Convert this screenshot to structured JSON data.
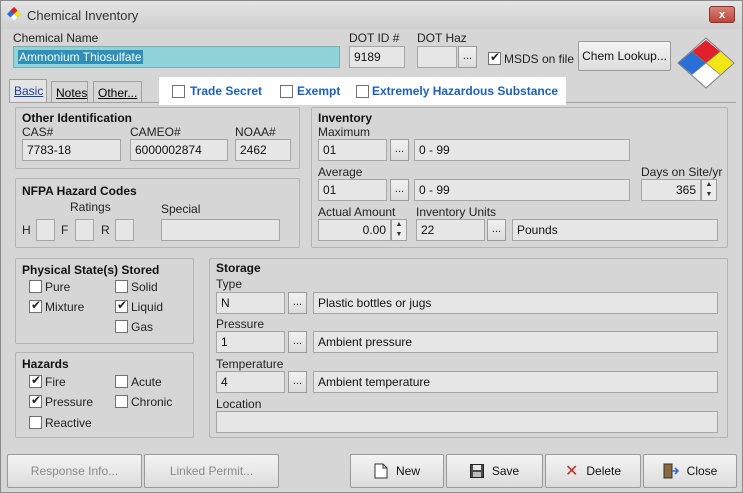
{
  "window": {
    "title": "Chemical Inventory",
    "close": "x"
  },
  "header": {
    "chemical_name_label": "Chemical Name",
    "chemical_name_value": "Ammonium Thiosulfate",
    "dot_id_label": "DOT ID #",
    "dot_id_value": "9189",
    "dot_haz_label": "DOT Haz",
    "dot_haz_value": "",
    "msds_label": "MSDS on file",
    "chem_lookup_label": "Chem Lookup..."
  },
  "tabs": [
    {
      "label": "Basic"
    },
    {
      "label": "Notes"
    },
    {
      "label": "Other..."
    }
  ],
  "flags": {
    "trade_secret": "Trade Secret",
    "exempt": "Exempt",
    "extremely_hazardous": "Extremely Hazardous Substance"
  },
  "other_identification": {
    "title": "Other Identification",
    "cas_label": "CAS#",
    "cas_value": "7783-18",
    "cameo_label": "CAMEO#",
    "cameo_value": "6000002874",
    "noaa_label": "NOAA#",
    "noaa_value": "2462"
  },
  "nfpa": {
    "title": "NFPA Hazard Codes",
    "ratings_label": "Ratings",
    "special_label": "Special",
    "h_label": "H",
    "f_label": "F",
    "r_label": "R"
  },
  "inventory": {
    "title": "Inventory",
    "maximum_label": "Maximum",
    "maximum_code": "01",
    "maximum_range": "0 - 99",
    "average_label": "Average",
    "average_code": "01",
    "average_range": "0 - 99",
    "days_label": "Days on Site/yr",
    "days_value": "365",
    "actual_label": "Actual Amount",
    "actual_value": "0.00",
    "units_label": "Inventory Units",
    "units_code": "22",
    "units_value": "Pounds"
  },
  "physical_state": {
    "title": "Physical State(s) Stored",
    "pure": "Pure",
    "solid": "Solid",
    "mixture": "Mixture",
    "liquid": "Liquid",
    "gas": "Gas"
  },
  "hazards": {
    "title": "Hazards",
    "fire": "Fire",
    "acute": "Acute",
    "pressure": "Pressure",
    "chronic": "Chronic",
    "reactive": "Reactive"
  },
  "storage": {
    "title": "Storage",
    "type_label": "Type",
    "type_code": "N",
    "type_value": "Plastic bottles or jugs",
    "pressure_label": "Pressure",
    "pressure_code": "1",
    "pressure_value": "Ambient pressure",
    "temperature_label": "Temperature",
    "temperature_code": "4",
    "temperature_value": "Ambient temperature",
    "location_label": "Location",
    "location_value": ""
  },
  "footer": {
    "response_info": "Response Info...",
    "linked_permit": "Linked Permit...",
    "new": "New",
    "save": "Save",
    "delete": "Delete",
    "close": "Close"
  },
  "dots": "...",
  "colors": {
    "selection": "#8fd3d8",
    "link": "#1b5fbf",
    "nfpa_blue": "#2a6fd6",
    "nfpa_red": "#e0202a",
    "nfpa_yellow": "#f2e616",
    "nfpa_white": "#ffffff"
  }
}
